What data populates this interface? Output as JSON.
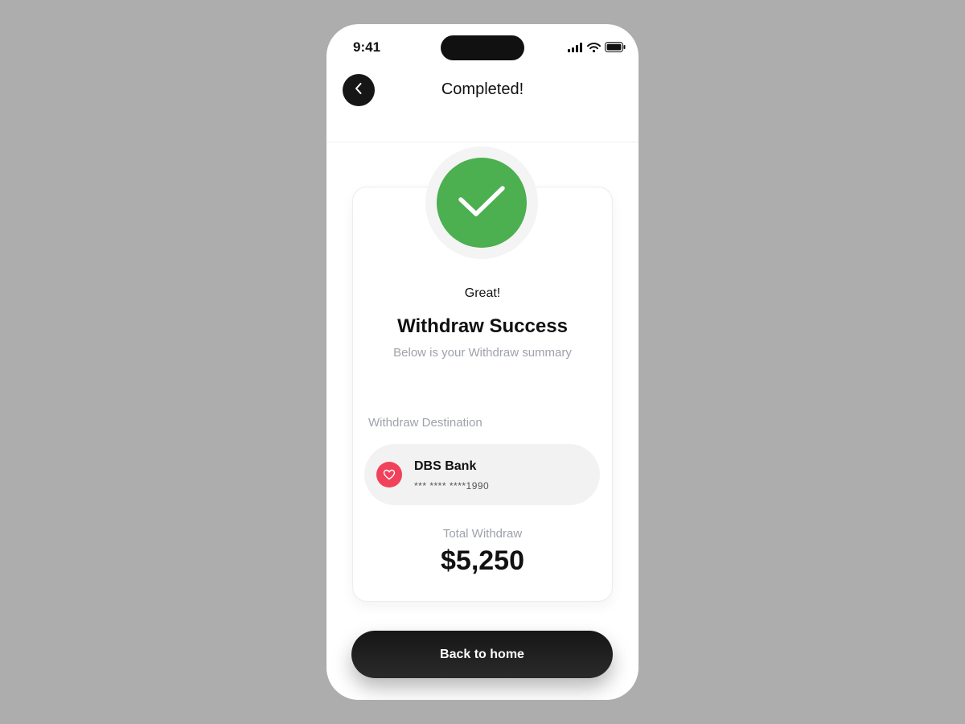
{
  "status_bar": {
    "time": "9:41",
    "icons": [
      "signal-icon",
      "wifi-icon",
      "battery-icon"
    ]
  },
  "header": {
    "title": "Completed!",
    "back_icon": "chevron-left-icon"
  },
  "result": {
    "icon": "checkmark-icon",
    "greeting": "Great!",
    "title": "Withdraw Success",
    "subtitle": "Below is your Withdraw summary"
  },
  "destination": {
    "label": "Withdraw Destination",
    "bank_name": "DBS Bank",
    "account_number": "*** **** ****1990",
    "logo_icon": "bank-heart-logo-icon"
  },
  "total": {
    "label": "Total Withdraw",
    "amount": "$5,250"
  },
  "actions": {
    "back_home_label": "Back to home"
  },
  "colors": {
    "success": "#4caf50",
    "bank_brand": "#f0425a",
    "primary_button": "#161616",
    "muted_text": "#9ea2ab",
    "background": "#adadad"
  }
}
